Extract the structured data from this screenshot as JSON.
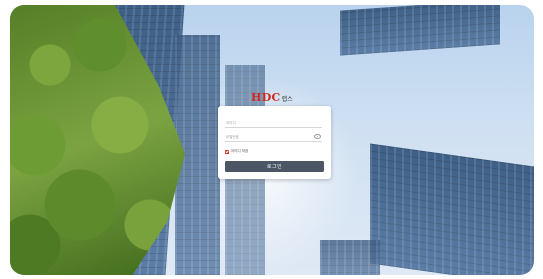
{
  "brand": {
    "logo_main": "HDC",
    "logo_sub": "랩스",
    "logo_color": "#d2281e"
  },
  "login_form": {
    "id_placeholder": "아이디",
    "password_placeholder": "비밀번호",
    "password_toggle_icon": "eye-icon",
    "remember_label": "아이디 저장",
    "remember_checked": true,
    "submit_label": "로그인",
    "button_color": "#4b5563"
  }
}
